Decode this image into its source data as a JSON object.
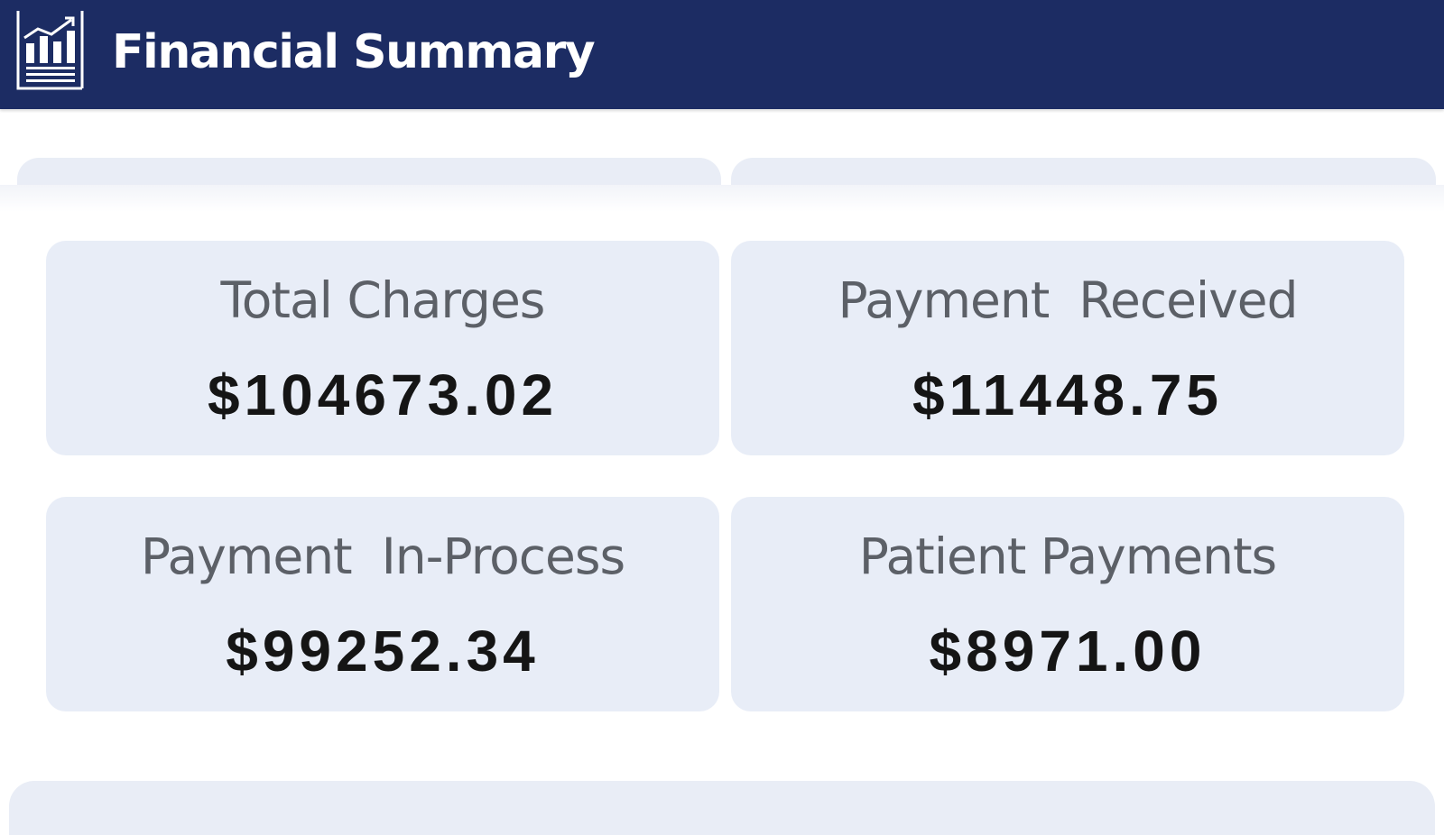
{
  "header": {
    "icon": "chart-report-icon",
    "title": "Financial Summary",
    "background": "#1c2c63"
  },
  "cards": [
    {
      "label": "Total Charges",
      "value": "$104673.02"
    },
    {
      "label": "Payment  Received",
      "value": "$11448.75"
    },
    {
      "label": "Payment  In-Process",
      "value": "$99252.34"
    },
    {
      "label": "Patient Payments",
      "value": "$8971.00"
    }
  ],
  "colors": {
    "card_background": "#e8edf7",
    "label_text": "#5c6067",
    "value_text": "#151515"
  }
}
